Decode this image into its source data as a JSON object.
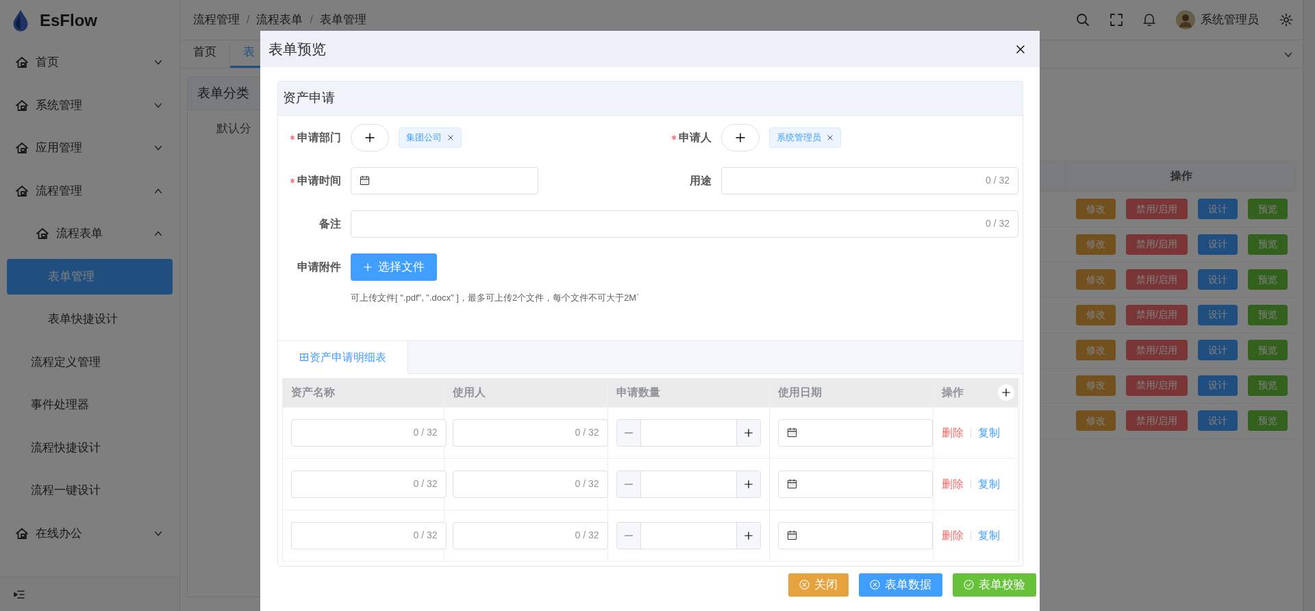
{
  "sidebar": {
    "logo": "EsFlow",
    "items": [
      {
        "label": "首页",
        "kind": "group",
        "expanded": false,
        "selected": false
      },
      {
        "label": "系统管理",
        "kind": "group",
        "expanded": false,
        "selected": false
      },
      {
        "label": "应用管理",
        "kind": "group",
        "expanded": false,
        "selected": false
      },
      {
        "label": "流程管理",
        "kind": "group",
        "expanded": true,
        "selected": false,
        "children": [
          {
            "label": "流程表单",
            "kind": "group",
            "expanded": true,
            "selected": false,
            "children": [
              {
                "label": "表单管理",
                "kind": "leaf",
                "selected": true
              },
              {
                "label": "表单快捷设计",
                "kind": "leaf",
                "selected": false
              }
            ]
          },
          {
            "label": "流程定义管理",
            "kind": "leaf",
            "selected": false
          },
          {
            "label": "事件处理器",
            "kind": "leaf",
            "selected": false
          },
          {
            "label": "流程快捷设计",
            "kind": "leaf",
            "selected": false
          },
          {
            "label": "流程一键设计",
            "kind": "leaf",
            "selected": false
          }
        ]
      },
      {
        "label": "在线办公",
        "kind": "group",
        "expanded": false,
        "selected": false
      }
    ]
  },
  "header": {
    "breadcrumb": [
      "流程管理",
      "流程表单",
      "表单管理"
    ],
    "breadcrumb_separator": "/",
    "user": "系统管理员"
  },
  "tabs": [
    {
      "label": "首页",
      "selected": false
    },
    {
      "label": "表",
      "selected": true
    }
  ],
  "category_panel": {
    "title": "表单分类",
    "items": [
      "默认分"
    ]
  },
  "table": {
    "columns": [
      "操作"
    ],
    "rows": [
      {
        "actions": [
          {
            "label": "修改",
            "kind": "edit"
          },
          {
            "label": "禁用/启用",
            "kind": "toggle"
          },
          {
            "label": "设计",
            "kind": "design"
          },
          {
            "label": "预览",
            "kind": "preview"
          }
        ]
      },
      {
        "actions": [
          {
            "label": "修改",
            "kind": "edit"
          },
          {
            "label": "禁用/启用",
            "kind": "toggle"
          },
          {
            "label": "设计",
            "kind": "design"
          },
          {
            "label": "预览",
            "kind": "preview"
          }
        ]
      },
      {
        "actions": [
          {
            "label": "修改",
            "kind": "edit"
          },
          {
            "label": "禁用/启用",
            "kind": "toggle"
          },
          {
            "label": "设计",
            "kind": "design"
          },
          {
            "label": "预览",
            "kind": "preview"
          }
        ]
      },
      {
        "actions": [
          {
            "label": "修改",
            "kind": "edit"
          },
          {
            "label": "禁用/启用",
            "kind": "toggle"
          },
          {
            "label": "设计",
            "kind": "design"
          },
          {
            "label": "预览",
            "kind": "preview"
          }
        ]
      },
      {
        "actions": [
          {
            "label": "修改",
            "kind": "edit"
          },
          {
            "label": "禁用/启用",
            "kind": "toggle"
          },
          {
            "label": "设计",
            "kind": "design"
          },
          {
            "label": "预览",
            "kind": "preview"
          }
        ]
      },
      {
        "actions": [
          {
            "label": "修改",
            "kind": "edit"
          },
          {
            "label": "禁用/启用",
            "kind": "toggle"
          },
          {
            "label": "设计",
            "kind": "design"
          },
          {
            "label": "预览",
            "kind": "preview"
          }
        ]
      },
      {
        "actions": [
          {
            "label": "修改",
            "kind": "edit"
          },
          {
            "label": "禁用/启用",
            "kind": "toggle"
          },
          {
            "label": "设计",
            "kind": "design"
          },
          {
            "label": "预览",
            "kind": "preview"
          }
        ]
      }
    ]
  },
  "modal": {
    "title": "表单预览",
    "form": {
      "title": "资产申请",
      "rows": [
        [
          {
            "kind": "picker",
            "label": "申请部门",
            "required": true,
            "tags": [
              "集团公司"
            ]
          },
          {
            "kind": "picker",
            "label": "申请人",
            "required": true,
            "tags": [
              "系统管理员"
            ]
          }
        ],
        [
          {
            "kind": "date",
            "label": "申请时间",
            "required": true
          },
          {
            "kind": "text",
            "label": "用途",
            "required": false,
            "counter": "0 / 32"
          }
        ],
        [
          {
            "kind": "text",
            "label": "备注",
            "required": false,
            "counter": "0 / 32"
          }
        ],
        [
          {
            "kind": "upload",
            "label": "申请附件",
            "required": false,
            "button": "选择文件",
            "hint": "可上传文件[ \".pdf\", \".docx\" ]，最多可上传2个文件，每个文件不可大于2M`"
          }
        ]
      ]
    },
    "subform": {
      "tab": {
        "label": "资产申请明细表",
        "selected": true
      },
      "columns": [
        {
          "label": "资产名称",
          "kind": "text"
        },
        {
          "label": "使用人",
          "kind": "text"
        },
        {
          "label": "申请数量",
          "kind": "number"
        },
        {
          "label": "使用日期",
          "kind": "date"
        },
        {
          "label": "操作",
          "kind": "actions"
        }
      ],
      "rows": [
        {
          "cells": [
            {
              "counter": "0 / 32"
            },
            {
              "counter": "0 / 32"
            }
          ],
          "actions": [
            {
              "label": "删除",
              "kind": "danger"
            },
            {
              "label": "复制",
              "kind": "primary"
            }
          ]
        },
        {
          "cells": [
            {
              "counter": "0 / 32"
            },
            {
              "counter": "0 / 32"
            }
          ],
          "actions": [
            {
              "label": "删除",
              "kind": "danger"
            },
            {
              "label": "复制",
              "kind": "primary"
            }
          ]
        },
        {
          "cells": [
            {
              "counter": "0 / 32"
            },
            {
              "counter": "0 / 32"
            }
          ],
          "actions": [
            {
              "label": "删除",
              "kind": "danger"
            },
            {
              "label": "复制",
              "kind": "primary"
            }
          ]
        }
      ]
    },
    "buttons": [
      {
        "label": "关闭",
        "color": "#e6a23c",
        "kind": "close"
      },
      {
        "label": "表单数据",
        "color": "#409eff",
        "kind": "close"
      },
      {
        "label": "表单校验",
        "color": "#67c23a",
        "kind": "check"
      }
    ]
  }
}
